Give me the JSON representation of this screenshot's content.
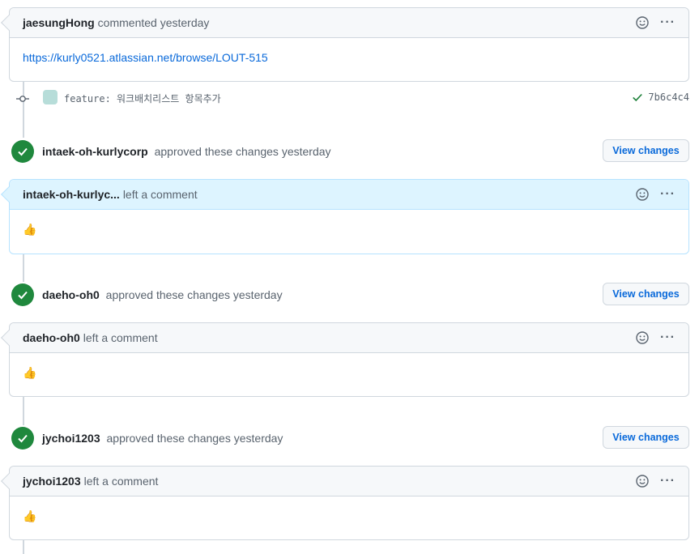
{
  "first_comment": {
    "author": "jaesungHong",
    "meta": "commented yesterday",
    "body_link": "https://kurly0521.atlassian.net/browse/LOUT-515"
  },
  "commit": {
    "message": "feature: 워크배치리스트 항목추가",
    "sha": "7b6c4c4"
  },
  "reviews": [
    {
      "reviewer": "intaek-oh-kurlycorp",
      "status_text": "approved these changes yesterday",
      "view_changes_label": "View changes",
      "comment_author": "intaek-oh-kurlyc...",
      "comment_meta": "left a comment",
      "comment_body": "👍"
    },
    {
      "reviewer": "daeho-oh0",
      "status_text": "approved these changes yesterday",
      "view_changes_label": "View changes",
      "comment_author": "daeho-oh0",
      "comment_meta": "left a comment",
      "comment_body": "👍"
    },
    {
      "reviewer": "jychoi1203",
      "status_text": "approved these changes yesterday",
      "view_changes_label": "View changes",
      "comment_author": "jychoi1203",
      "comment_meta": "left a comment",
      "comment_body": "👍"
    }
  ],
  "icons": {
    "approved": "check-icon",
    "commit": "git-commit-icon",
    "reaction": "smiley-icon",
    "more": "kebab-horizontal-icon",
    "verified": "check-icon"
  },
  "colors": {
    "approved_green": "#1f883d",
    "link_blue": "#0969da",
    "highlight_bg": "#ddf4ff"
  }
}
